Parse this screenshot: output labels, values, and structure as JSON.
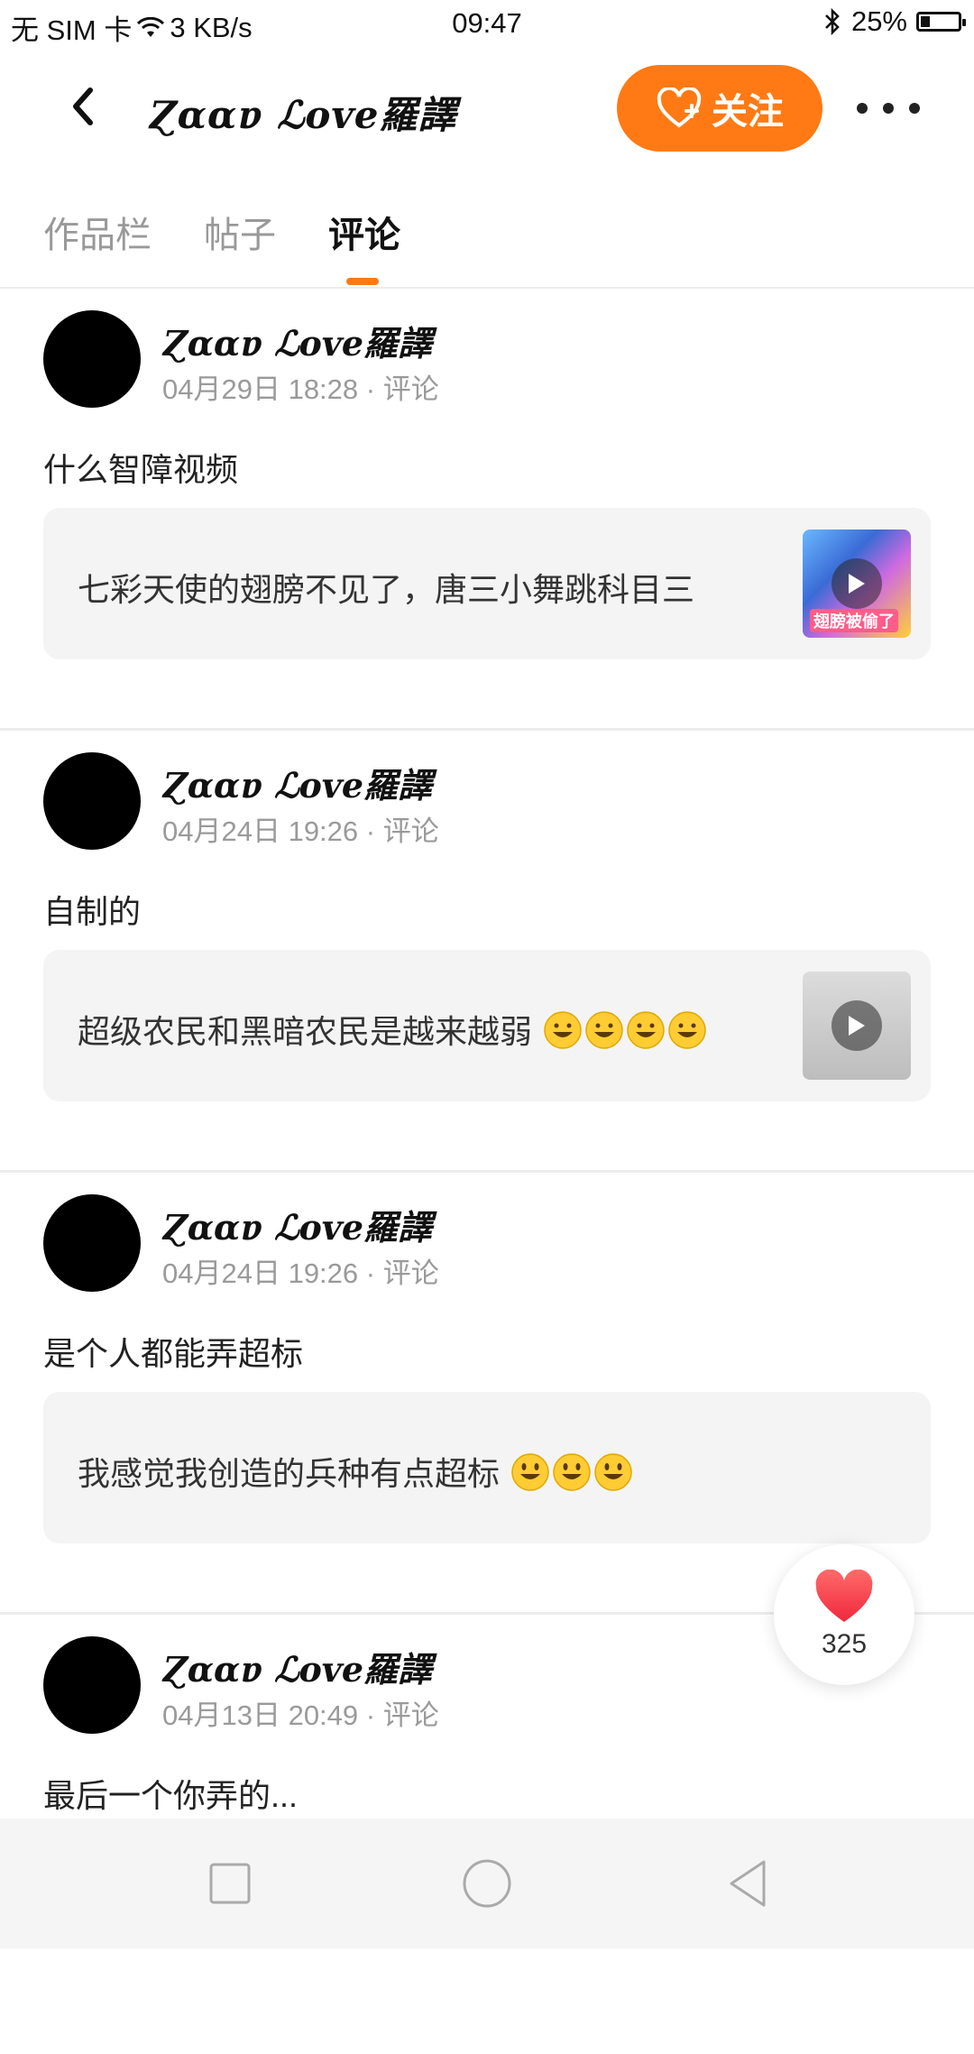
{
  "status_bar": {
    "carrier": "无 SIM 卡",
    "speed": "3 KB/s",
    "time": "09:47",
    "battery": "25%",
    "battery_level": 0.25
  },
  "header": {
    "title": "Ɀɑɑɐ ℒoᴠe羅譯",
    "follow_label": "关注",
    "accent_color": "#ff7a14"
  },
  "tabs": [
    {
      "label": "作品栏",
      "active": false
    },
    {
      "label": "帖子",
      "active": false
    },
    {
      "label": "评论",
      "active": true
    }
  ],
  "posts": [
    {
      "author": "Ɀɑɑɐ ℒoᴠe羅譯",
      "meta": "04月29日 18:28 · 评论",
      "text": "什么智障视频",
      "quote": "七彩天使的翅膀不见了，唐三小舞跳科目三",
      "thumb_caption": "翅膀被偷了"
    },
    {
      "author": "Ɀɑɑɐ ℒoᴠe羅譯",
      "meta": "04月24日 19:26 · 评论",
      "text": "自制的",
      "quote": "超级农民和黑暗农民是越来越弱"
    },
    {
      "author": "Ɀɑɑɐ ℒoᴠe羅譯",
      "meta": "04月24日 19:26 · 评论",
      "text": "是个人都能弄超标",
      "quote": "我感觉我创造的兵种有点超标"
    },
    {
      "author": "Ɀɑɑɐ ℒoᴠe羅譯",
      "meta": "04月13日 20:49 · 评论",
      "text": "最后一个你弄的..."
    }
  ],
  "like": {
    "count": "325"
  }
}
